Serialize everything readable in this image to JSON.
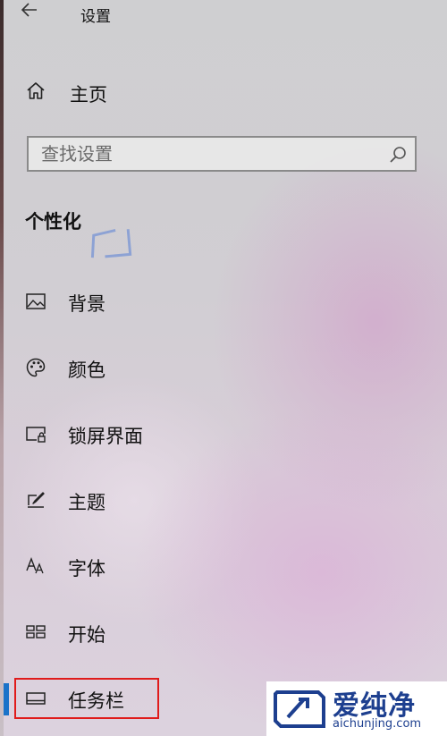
{
  "window": {
    "title": "设置"
  },
  "home": {
    "label": "主页"
  },
  "search": {
    "placeholder": "查找设置"
  },
  "section": {
    "header": "个性化"
  },
  "nav": {
    "items": [
      {
        "label": "背景",
        "icon": "picture-icon"
      },
      {
        "label": "颜色",
        "icon": "palette-icon"
      },
      {
        "label": "锁屏界面",
        "icon": "lock-screen-icon"
      },
      {
        "label": "主题",
        "icon": "theme-brush-icon"
      },
      {
        "label": "字体",
        "icon": "font-icon"
      },
      {
        "label": "开始",
        "icon": "start-grid-icon"
      },
      {
        "label": "任务栏",
        "icon": "taskbar-icon"
      }
    ],
    "active_index": 6
  },
  "watermark": {
    "brand": "爱纯净",
    "url": "aichunjing.com"
  },
  "colors": {
    "accent": "#1a73c9",
    "highlight": "#e01b1b",
    "brand": "#1d3f8f"
  }
}
